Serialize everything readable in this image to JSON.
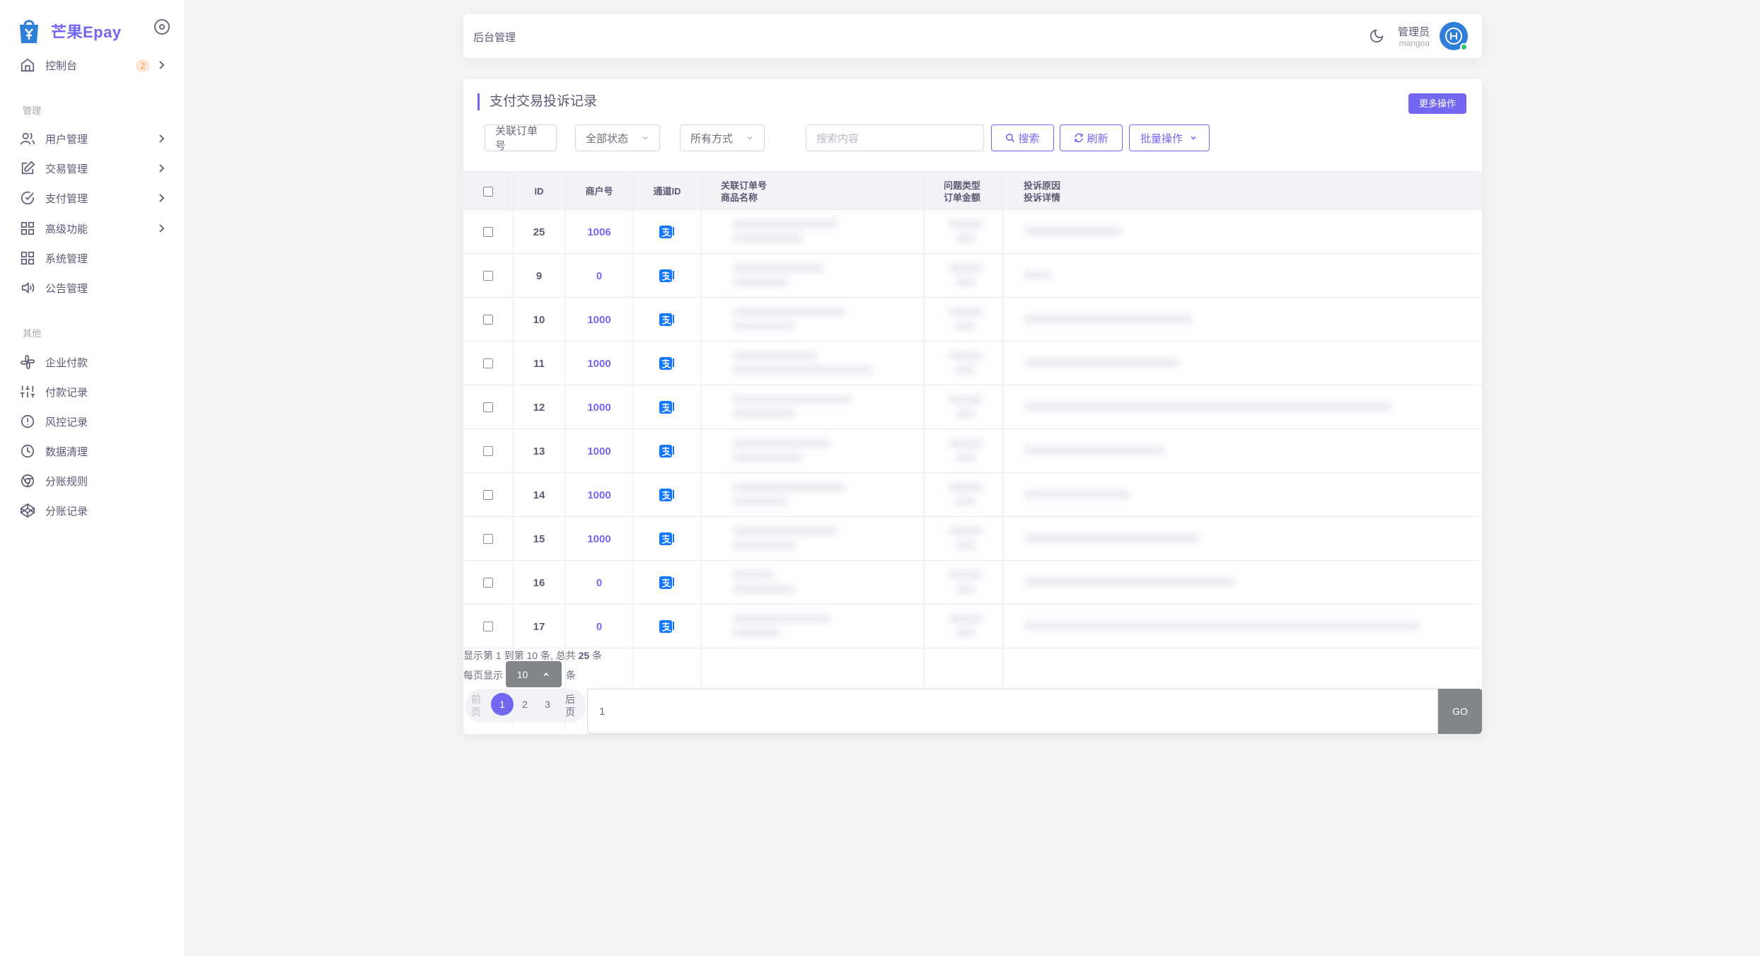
{
  "sidebar": {
    "brand": "芒果Epay",
    "dashboard": {
      "label": "控制台",
      "badge": "2"
    },
    "sections": {
      "manage": "管理",
      "other": "其他"
    },
    "manage_items": [
      {
        "label": "用户管理",
        "icon": "user-icon",
        "has_children": true
      },
      {
        "label": "交易管理",
        "icon": "edit-icon",
        "has_children": true
      },
      {
        "label": "支付管理",
        "icon": "check-circle-icon",
        "has_children": true
      },
      {
        "label": "高级功能",
        "icon": "grid-icon",
        "has_children": true
      },
      {
        "label": "系统管理",
        "icon": "grid-icon",
        "has_children": false
      },
      {
        "label": "公告管理",
        "icon": "speaker-icon",
        "has_children": false
      }
    ],
    "other_items": [
      {
        "label": "企业付款",
        "icon": "slack-icon"
      },
      {
        "label": "付款记录",
        "icon": "sliders-icon"
      },
      {
        "label": "风控记录",
        "icon": "alert-circle-icon"
      },
      {
        "label": "数据清理",
        "icon": "clock-icon"
      },
      {
        "label": "分账规则",
        "icon": "chrome-icon"
      },
      {
        "label": "分账记录",
        "icon": "codepen-icon"
      }
    ]
  },
  "header": {
    "title": "后台管理",
    "user_name": "管理员",
    "user_role": "mangoa"
  },
  "card": {
    "title": "支付交易投诉记录",
    "more_button": "更多操作",
    "filters": {
      "order_field": "关联订单号",
      "status_select": "全部状态",
      "method_select": "所有方式",
      "search_placeholder": "搜索内容"
    },
    "buttons": {
      "search": "搜索",
      "refresh": "刷新",
      "batch": "批量操作"
    }
  },
  "table": {
    "headers": {
      "id": "ID",
      "merchant": "商户号",
      "channel": "通道ID",
      "order_line1": "关联订单号",
      "order_line2": "商品名称",
      "type_line1": "问题类型",
      "type_line2": "订单金额",
      "reason_line1": "投诉原因",
      "reason_line2": "投诉详情"
    },
    "rows": [
      {
        "id": "25",
        "merchant": "1006"
      },
      {
        "id": "9",
        "merchant": "0"
      },
      {
        "id": "10",
        "merchant": "1000"
      },
      {
        "id": "11",
        "merchant": "1000"
      },
      {
        "id": "12",
        "merchant": "1000"
      },
      {
        "id": "13",
        "merchant": "1000"
      },
      {
        "id": "14",
        "merchant": "1000"
      },
      {
        "id": "15",
        "merchant": "1000"
      },
      {
        "id": "16",
        "merchant": "0"
      },
      {
        "id": "17",
        "merchant": "0"
      }
    ]
  },
  "pager": {
    "info_prefix": "显示第 1 到第 10 条, 总共",
    "total": "25",
    "info_suffix": "条",
    "per_page_label": "每页显示",
    "per_page": "10",
    "per_page_suffix": "条",
    "prev": "前页",
    "next": "后页",
    "pages": [
      "1",
      "2",
      "3"
    ],
    "active_page": "1",
    "jump_value": "1",
    "go": "GO"
  },
  "colors": {
    "accent": "#7367f0",
    "success": "#28c76f",
    "warning": "#ff9f43",
    "secondary": "#82868b"
  }
}
